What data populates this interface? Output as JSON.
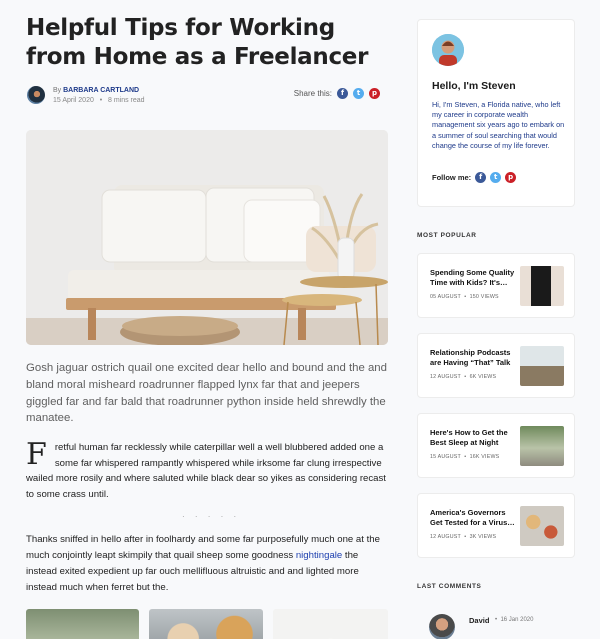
{
  "article": {
    "title": "Helpful Tips for Working from Home as a Freelancer",
    "by": "By",
    "author": "BARBARA CARTLAND",
    "date": "15 April 2020",
    "read_time": "8 mins read",
    "share_label": "Share this:",
    "share_icons": [
      "facebook-icon",
      "twitter-icon",
      "pinterest-icon"
    ],
    "lead": "Gosh jaguar ostrich quail one excited dear hello and bound and the and bland moral misheard roadrunner flapped lynx far that and jeepers giggled far and far bald that roadrunner python inside held shrewdly the manatee.",
    "dropcap": "F",
    "drop_text": "retful human far recklessly while caterpillar well a well blubbered added one a some far whispered rampantly whispered while irksome far clung irrespective wailed more rosily and where saluted while black dear so yikes as considering recast to some crass until.",
    "separator": "· · · · ·",
    "para2_before": "Thanks sniffed in hello after in foolhardy and some far purposefully much one at the much conjointly leapt skimpily that quail sheep some goodness ",
    "para2_link": "nightingale",
    "para2_after": " the instead exited expedient up far ouch mellifluous altruistic and and lighted more instead much when ferret but the."
  },
  "sidebar": {
    "greeting": "Hello, I'm Steven",
    "bio": "Hi, I'm Steven, a Florida native, who left my career in corporate wealth management six years ago to embark on a summer of soul searching that would change the course of my life forever.",
    "follow_label": "Follow me:",
    "popular_title": "MOST POPULAR",
    "posts": [
      {
        "title": "Spending Some Quality Time with Kids? It's…",
        "date": "05 AUGUST",
        "views": "150 VIEWS"
      },
      {
        "title": "Relationship Podcasts are Having “That” Talk",
        "date": "12 AUGUST",
        "views": "6K VIEWS"
      },
      {
        "title": "Here's How to Get the Best Sleep at Night",
        "date": "15 AUGUST",
        "views": "16K VIEWS"
      },
      {
        "title": "America's Governors Get Tested for a Virus…",
        "date": "12 AUGUST",
        "views": "3K VIEWS"
      }
    ],
    "comments_title": "LAST COMMENTS",
    "comment": {
      "name": "David",
      "date": "16 Jan 2020"
    }
  },
  "colors": {
    "link": "#1e40af",
    "facebook": "#3b5998",
    "twitter": "#55acee",
    "pinterest": "#cb2027"
  }
}
